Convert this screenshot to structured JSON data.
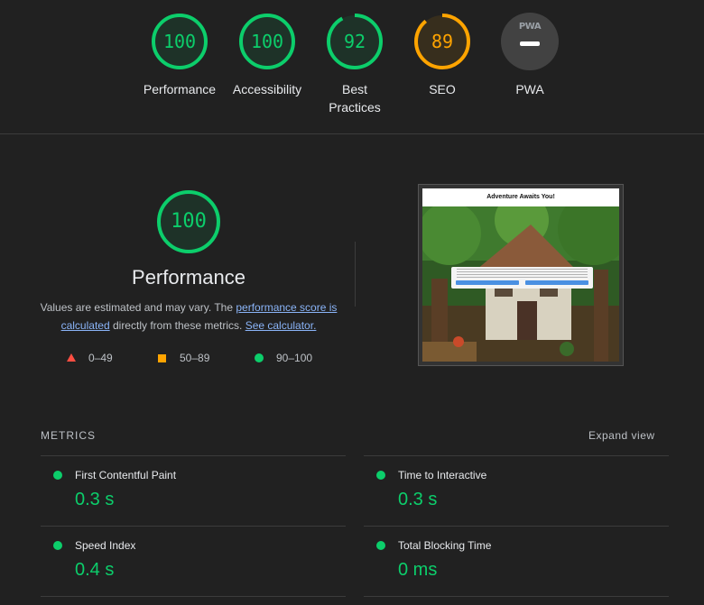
{
  "top_gauges": [
    {
      "name": "performance",
      "score": "100",
      "score_fraction": 1.0,
      "label": "Performance",
      "color": "#0cce6b"
    },
    {
      "name": "accessibility",
      "score": "100",
      "score_fraction": 1.0,
      "label": "Accessibility",
      "color": "#0cce6b"
    },
    {
      "name": "best-practices",
      "score": "92",
      "score_fraction": 0.92,
      "label": "Best Practices",
      "color": "#0cce6b"
    },
    {
      "name": "seo",
      "score": "89",
      "score_fraction": 0.89,
      "label": "SEO",
      "color": "#ffa400"
    }
  ],
  "pwa": {
    "badge_text": "PWA",
    "label": "PWA"
  },
  "performance_section": {
    "score": "100",
    "score_fraction": 1.0,
    "title": "Performance",
    "desc_prefix": "Values are estimated and may vary. The ",
    "link_score": "performance score is calculated",
    "desc_middle": " directly from these metrics. ",
    "link_calculator": "See calculator.",
    "legend": [
      {
        "range": "0–49",
        "shape": "triangle",
        "color": "#ff4e42"
      },
      {
        "range": "50–89",
        "shape": "square",
        "color": "#ffa400"
      },
      {
        "range": "90–100",
        "shape": "circle",
        "color": "#0cce6b"
      }
    ]
  },
  "screenshot": {
    "header_title": "Adventure Awaits You!"
  },
  "metrics": {
    "heading": "METRICS",
    "expand_label": "Expand view",
    "items": [
      {
        "name": "First Contentful Paint",
        "value": "0.3 s"
      },
      {
        "name": "Time to Interactive",
        "value": "0.3 s"
      },
      {
        "name": "Speed Index",
        "value": "0.4 s"
      },
      {
        "name": "Total Blocking Time",
        "value": "0 ms"
      }
    ]
  },
  "colors": {
    "pass": "#0cce6b",
    "average": "#ffa400",
    "fail": "#ff4e42",
    "background": "#212121",
    "link": "#8ab4f8"
  }
}
